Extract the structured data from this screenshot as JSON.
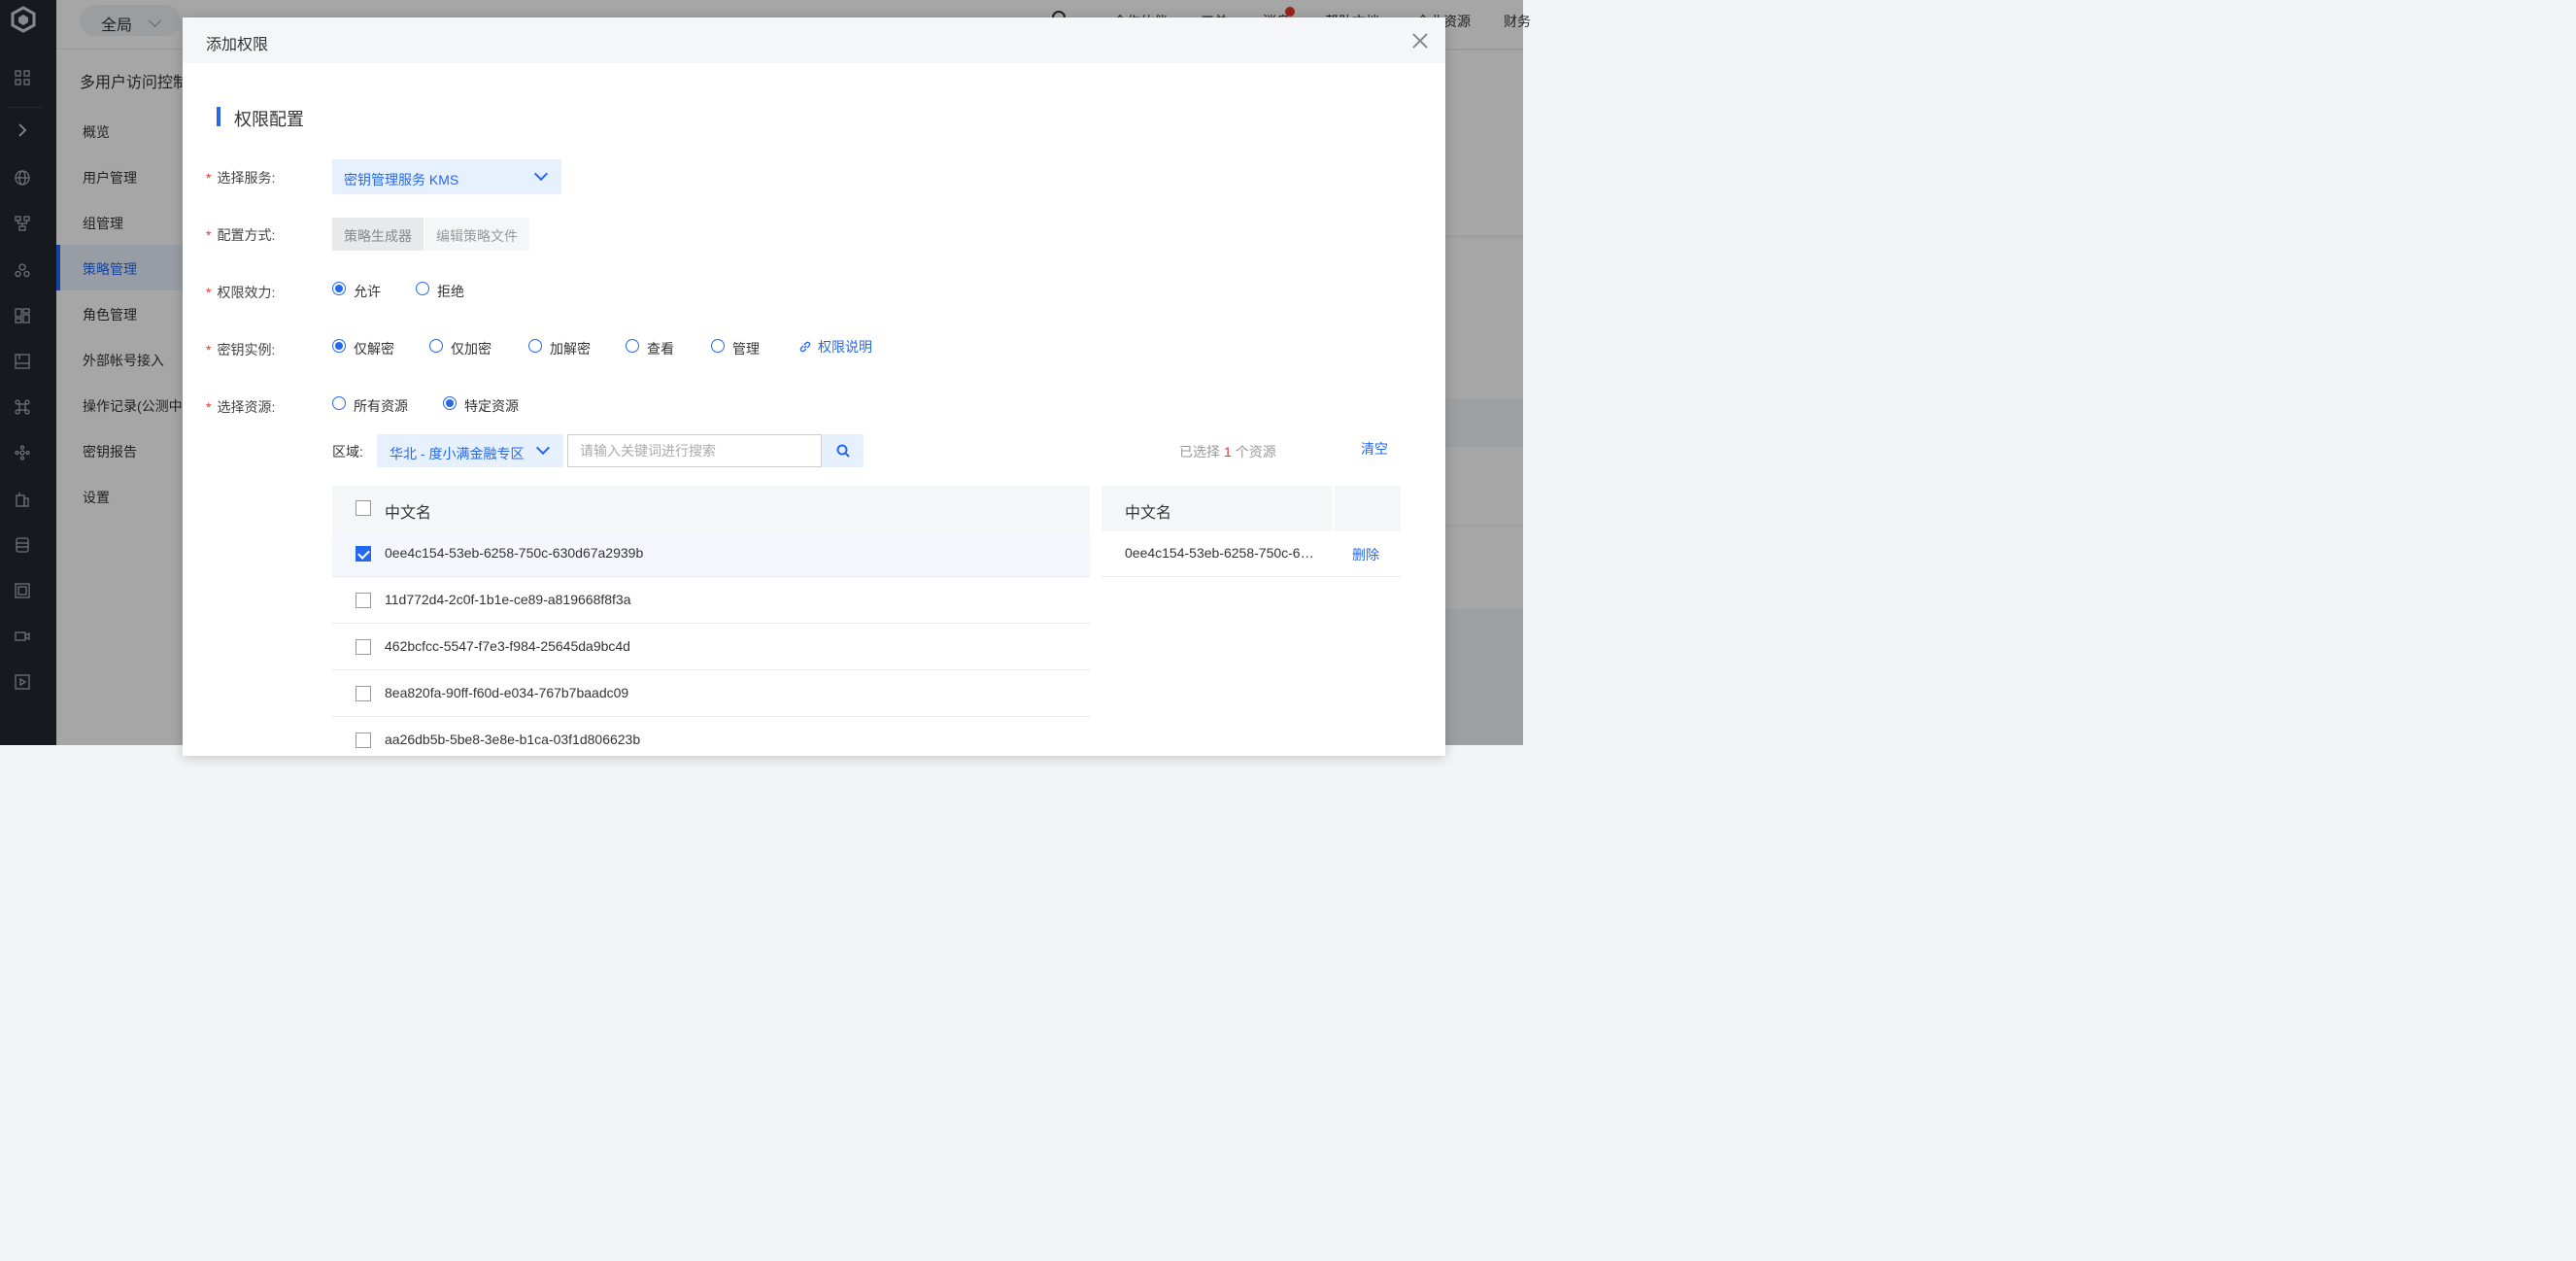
{
  "topbar": {
    "scope": "全局",
    "nav": [
      "合作伙伴",
      "工单",
      "消息",
      "帮助文档",
      "企业资源",
      "财务"
    ]
  },
  "sidebar": {
    "title": "多用户访问控制",
    "items": [
      {
        "label": "概览"
      },
      {
        "label": "用户管理"
      },
      {
        "label": "组管理"
      },
      {
        "label": "策略管理",
        "active": true
      },
      {
        "label": "角色管理"
      },
      {
        "label": "外部帐号接入"
      },
      {
        "label": "操作记录(公测中)"
      },
      {
        "label": "密钥报告"
      },
      {
        "label": "设置"
      }
    ]
  },
  "modal": {
    "title": "添加权限",
    "section": "权限配置",
    "required_mark": "*",
    "service": {
      "label": "选择服务:",
      "value": "密钥管理服务 KMS"
    },
    "config": {
      "label": "配置方式:",
      "options": [
        "策略生成器",
        "编辑策略文件"
      ],
      "selected": "策略生成器"
    },
    "effect": {
      "label": "权限效力:",
      "options": [
        "允许",
        "拒绝"
      ],
      "selected": "允许"
    },
    "instance": {
      "label": "密钥实例:",
      "options": [
        "仅解密",
        "仅加密",
        "加解密",
        "查看",
        "管理"
      ],
      "selected": "仅解密",
      "help_link": "权限说明"
    },
    "resource": {
      "label": "选择资源:",
      "options": [
        "所有资源",
        "特定资源"
      ],
      "selected": "特定资源"
    },
    "region": {
      "label": "区域:",
      "value": "华北 - 度小满金融专区"
    },
    "search": {
      "placeholder": "请输入关键词进行搜索"
    },
    "selection": {
      "prefix": "已选择",
      "count": "1",
      "suffix": "个资源",
      "clear": "清空"
    },
    "table": {
      "header": "中文名",
      "rows": [
        {
          "name": "0ee4c154-53eb-6258-750c-630d67a2939b",
          "checked": true
        },
        {
          "name": "11d772d4-2c0f-1b1e-ce89-a819668f8f3a",
          "checked": false
        },
        {
          "name": "462bcfcc-5547-f7e3-f984-25645da9bc4d",
          "checked": false
        },
        {
          "name": "8ea820fa-90ff-f60d-e034-767b7baadc09",
          "checked": false
        },
        {
          "name": "aa26db5b-5be8-3e8e-b1ca-03f1d806623b",
          "checked": false
        }
      ]
    },
    "selected_table": {
      "header": "中文名",
      "rows": [
        {
          "name": "0ee4c154-53eb-6258-750c-630d67a2939b",
          "action": "删除"
        }
      ]
    }
  }
}
